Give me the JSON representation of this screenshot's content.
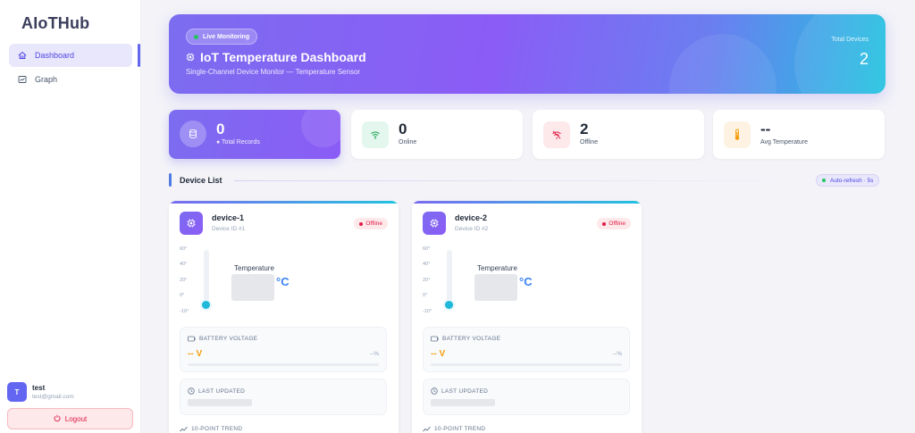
{
  "sidebar": {
    "brand": "AIoTHub",
    "items": [
      {
        "label": "Dashboard",
        "icon": "home-icon",
        "active": true
      },
      {
        "label": "Graph",
        "icon": "chart-icon",
        "active": false
      }
    ],
    "user": {
      "initial": "T",
      "name": "test",
      "email": "test@gmail.com"
    },
    "logout_label": "Logout"
  },
  "hero": {
    "badge": "Live Monitoring",
    "title": "IoT Temperature Dashboard",
    "subtitle": "Single-Channel Device Monitor — Temperature Sensor",
    "total_label": "Total Devices",
    "total_value": "2"
  },
  "stats": [
    {
      "value": "0",
      "label": "● Total Records",
      "icon": "database-icon"
    },
    {
      "value": "0",
      "label": "Online",
      "icon": "wifi-icon"
    },
    {
      "value": "2",
      "label": "Offline",
      "icon": "wifi-off-icon"
    },
    {
      "value": "--",
      "label": "Avg Temperature",
      "icon": "thermometer-icon"
    }
  ],
  "device_list": {
    "title": "Device List",
    "auto_refresh": "Auto-refresh · 5s"
  },
  "devices": [
    {
      "name": "device-1",
      "id_label": "Device ID #1",
      "status": "Offline",
      "scale": [
        "60°",
        "40°",
        "20°",
        "0°",
        "-10°"
      ],
      "temp_label": "Temperature",
      "temp_unit": "°C",
      "battery_title": "BATTERY VOLTAGE",
      "battery_value": "-- V",
      "battery_pct": "--%",
      "updated_title": "LAST UPDATED",
      "trend_title": "10-POINT TREND"
    },
    {
      "name": "device-2",
      "id_label": "Device ID #2",
      "status": "Offline",
      "scale": [
        "60°",
        "40°",
        "20°",
        "0°",
        "-10°"
      ],
      "temp_label": "Temperature",
      "temp_unit": "°C",
      "battery_title": "BATTERY VOLTAGE",
      "battery_value": "-- V",
      "battery_pct": "--%",
      "updated_title": "LAST UPDATED",
      "trend_title": "10-POINT TREND"
    }
  ],
  "colors": {
    "accent": "#6366f1",
    "offline": "#e11d48",
    "voltage": "#f59e0b",
    "unit": "#3b82f6"
  }
}
